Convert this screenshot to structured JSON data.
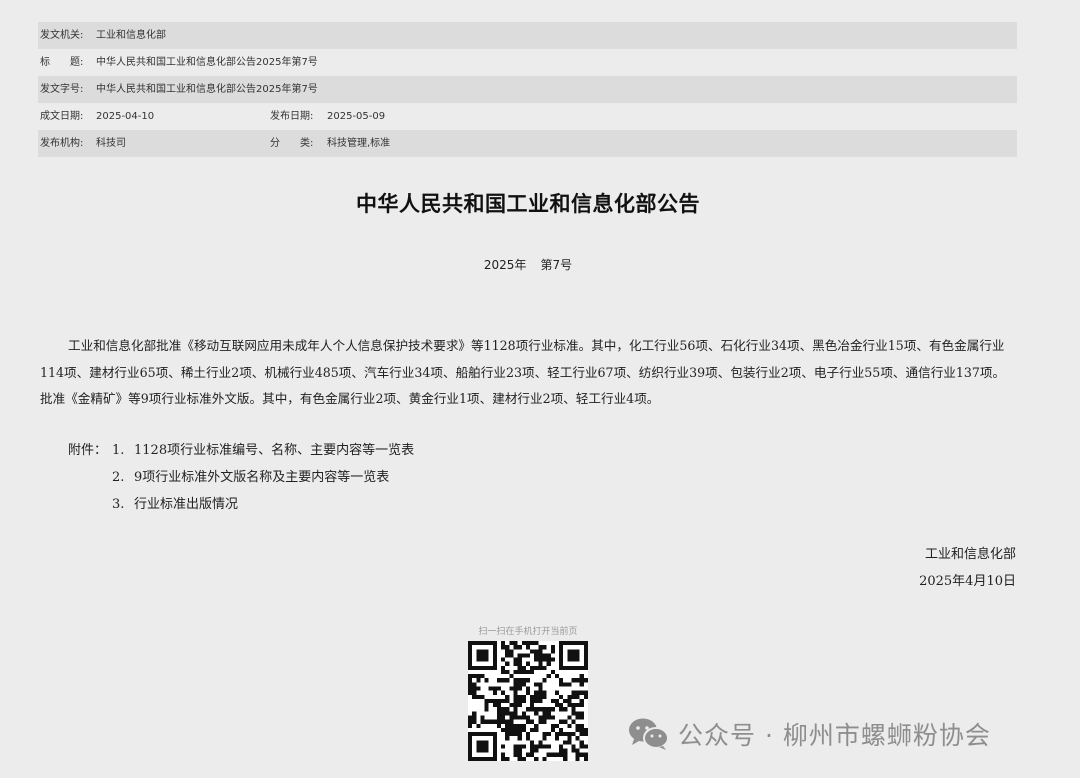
{
  "meta": {
    "issuer_label": "发文机关:",
    "issuer": "工业和信息化部",
    "title_label": "标　　题:",
    "title": "中华人民共和国工业和信息化部公告2025年第7号",
    "docno_label": "发文字号:",
    "docno": "中华人民共和国工业和信息化部公告2025年第7号",
    "written_label": "成文日期:",
    "written": "2025-04-10",
    "published_label": "发布日期:",
    "published": "2025-05-09",
    "org_label": "发布机构:",
    "org": "科技司",
    "category_label": "分　　类:",
    "category": "科技管理,标准"
  },
  "heading": "中华人民共和国工业和信息化部公告",
  "issue": {
    "year": "2025年",
    "number": "第7号"
  },
  "body": "工业和信息化部批准《移动互联网应用未成年人个人信息保护技术要求》等1128项行业标准。其中，化工行业56项、石化行业34项、黑色冶金行业15项、有色金属行业114项、建材行业65项、稀土行业2项、机械行业485项、汽车行业34项、船舶行业23项、轻工行业67项、纺织行业39项、包装行业2项、电子行业55项、通信行业137项。批准《金精矿》等9项行业标准外文版。其中，有色金属行业2项、黄金行业1项、建材行业2项、轻工行业4项。",
  "attachments": {
    "label": "附件：",
    "items": [
      {
        "num": "1.",
        "text": "1128项行业标准编号、名称、主要内容等一览表"
      },
      {
        "num": "2.",
        "text": "9项行业标准外文版名称及主要内容等一览表"
      },
      {
        "num": "3.",
        "text": "行业标准出版情况"
      }
    ]
  },
  "signature": {
    "org": "工业和信息化部",
    "date": "2025年4月10日"
  },
  "qr_caption": "扫一扫在手机打开当前页",
  "watermark": "公众号 · 柳州市螺蛳粉协会",
  "icons": {
    "qr": "qr-code-icon",
    "wechat": "wechat-icon"
  }
}
